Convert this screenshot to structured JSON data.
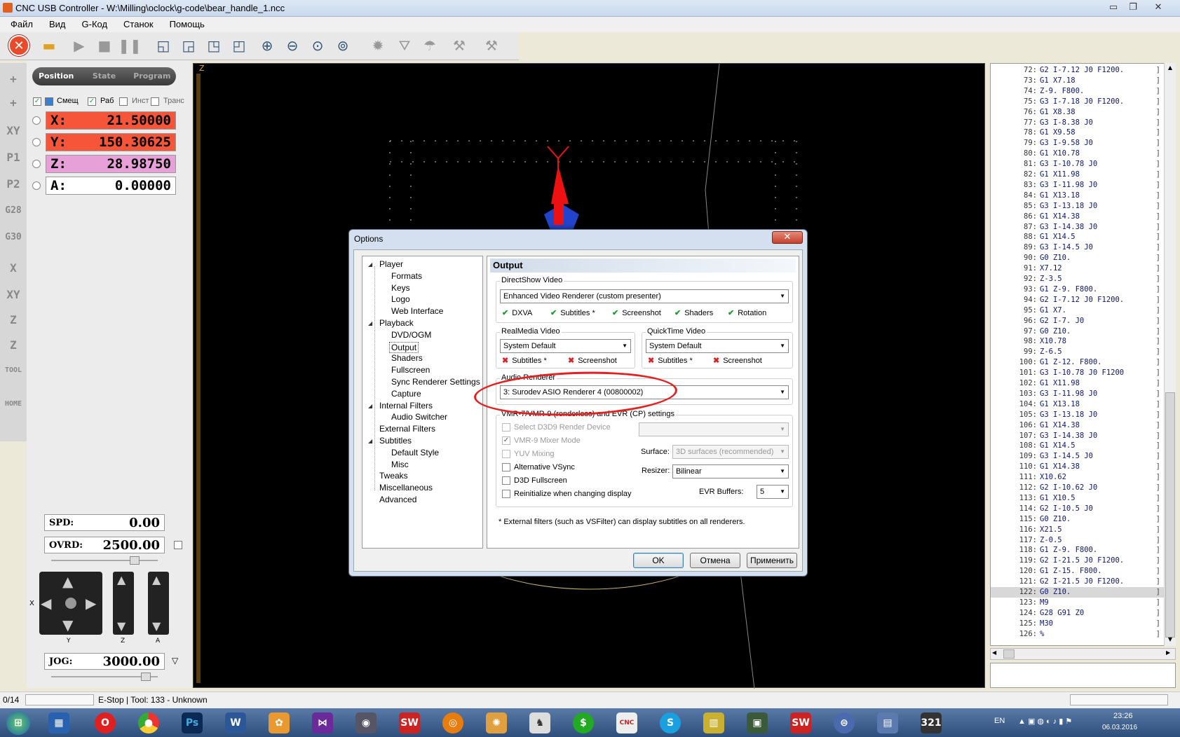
{
  "window": {
    "title": "CNC USB Controller - W:\\Milling\\oclock\\g-code\\bear_handle_1.ncc",
    "minimize": "▭",
    "restore": "❐",
    "close": "✕"
  },
  "menu": [
    "Файл",
    "Вид",
    "G-Код",
    "Станок",
    "Помощь"
  ],
  "position_panel": {
    "tabs": [
      "Position",
      "State",
      "Program"
    ],
    "checkboxes": [
      {
        "label": "Смещ",
        "checked": true
      },
      {
        "label": "Раб",
        "checked": true
      },
      {
        "label": "Инст",
        "checked": false
      },
      {
        "label": "Транс",
        "checked": false
      }
    ],
    "axes": [
      {
        "name": "X:",
        "value": "21.50000",
        "color": "#f7553a"
      },
      {
        "name": "Y:",
        "value": "150.30625",
        "color": "#f7553a"
      },
      {
        "name": "Z:",
        "value": "28.98750",
        "color": "#e8a0d8"
      },
      {
        "name": "A:",
        "value": "0.00000",
        "color": "#ffffff"
      }
    ]
  },
  "left_strip": [
    "+",
    "+",
    "XY",
    "P1",
    "P2",
    "G28",
    "G30",
    "X",
    "XY",
    "Z",
    "Z",
    "TOOL",
    "HOME"
  ],
  "controls": {
    "spd_label": "SPD:",
    "spd_value": "0.00",
    "ovrd_label": "OVRD:",
    "ovrd_value": "2500.00",
    "jog_label": "JOG:",
    "jog_value": "3000.00",
    "jog_axes": {
      "x": "X",
      "y": "Y",
      "z": "Z",
      "a": "A"
    }
  },
  "viewport": {
    "axis_label": "Z"
  },
  "gcode": [
    {
      "n": "72:",
      "t": "G2 I-7.12 J0 F1200."
    },
    {
      "n": "73:",
      "t": "G1 X7.18"
    },
    {
      "n": "74:",
      "t": "Z-9. F800."
    },
    {
      "n": "75:",
      "t": "G3 I-7.18 J0 F1200."
    },
    {
      "n": "76:",
      "t": "G1 X8.38"
    },
    {
      "n": "77:",
      "t": "G3 I-8.38 J0"
    },
    {
      "n": "78:",
      "t": "G1 X9.58"
    },
    {
      "n": "79:",
      "t": "G3 I-9.58 J0"
    },
    {
      "n": "80:",
      "t": "G1 X10.78"
    },
    {
      "n": "81:",
      "t": "G3 I-10.78 J0"
    },
    {
      "n": "82:",
      "t": "G1 X11.98"
    },
    {
      "n": "83:",
      "t": "G3 I-11.98 J0"
    },
    {
      "n": "84:",
      "t": "G1 X13.18"
    },
    {
      "n": "85:",
      "t": "G3 I-13.18 J0"
    },
    {
      "n": "86:",
      "t": "G1 X14.38"
    },
    {
      "n": "87:",
      "t": "G3 I-14.38 J0"
    },
    {
      "n": "88:",
      "t": "G1 X14.5"
    },
    {
      "n": "89:",
      "t": "G3 I-14.5 J0"
    },
    {
      "n": "90:",
      "t": "G0 Z10."
    },
    {
      "n": "91:",
      "t": "X7.12"
    },
    {
      "n": "92:",
      "t": "Z-3.5"
    },
    {
      "n": "93:",
      "t": "G1 Z-9. F800."
    },
    {
      "n": "94:",
      "t": "G2 I-7.12 J0 F1200."
    },
    {
      "n": "95:",
      "t": "G1 X7."
    },
    {
      "n": "96:",
      "t": "G2 I-7. J0"
    },
    {
      "n": "97:",
      "t": "G0 Z10."
    },
    {
      "n": "98:",
      "t": "X10.78"
    },
    {
      "n": "99:",
      "t": "Z-6.5"
    },
    {
      "n": "100:",
      "t": "G1 Z-12. F800."
    },
    {
      "n": "101:",
      "t": "G3 I-10.78 J0 F1200"
    },
    {
      "n": "102:",
      "t": "G1 X11.98"
    },
    {
      "n": "103:",
      "t": "G3 I-11.98 J0"
    },
    {
      "n": "104:",
      "t": "G1 X13.18"
    },
    {
      "n": "105:",
      "t": "G3 I-13.18 J0"
    },
    {
      "n": "106:",
      "t": "G1 X14.38"
    },
    {
      "n": "107:",
      "t": "G3 I-14.38 J0"
    },
    {
      "n": "108:",
      "t": "G1 X14.5"
    },
    {
      "n": "109:",
      "t": "G3 I-14.5 J0"
    },
    {
      "n": "110:",
      "t": "G1 X14.38"
    },
    {
      "n": "111:",
      "t": "X10.62"
    },
    {
      "n": "112:",
      "t": "G2 I-10.62 J0"
    },
    {
      "n": "113:",
      "t": "G1 X10.5"
    },
    {
      "n": "114:",
      "t": "G2 I-10.5 J0"
    },
    {
      "n": "115:",
      "t": "G0 Z10."
    },
    {
      "n": "116:",
      "t": "X21.5"
    },
    {
      "n": "117:",
      "t": "Z-0.5"
    },
    {
      "n": "118:",
      "t": "G1 Z-9. F800."
    },
    {
      "n": "119:",
      "t": "G2 I-21.5 J0 F1200."
    },
    {
      "n": "120:",
      "t": "G1 Z-15. F800."
    },
    {
      "n": "121:",
      "t": "G2 I-21.5 J0 F1200."
    },
    {
      "n": "122:",
      "t": "G0 Z10."
    },
    {
      "n": "123:",
      "t": "M9"
    },
    {
      "n": "124:",
      "t": "G28 G91 Z0"
    },
    {
      "n": "125:",
      "t": "M30"
    },
    {
      "n": "126:",
      "t": "%"
    }
  ],
  "status": {
    "progress": "0/14",
    "info": "E-Stop | Tool: 133 - Unknown"
  },
  "tray": {
    "lang": "EN",
    "time": "23:26",
    "date": "06.03.2016"
  },
  "dialog": {
    "title": "Options",
    "close": "✕",
    "tree": [
      {
        "label": "Player",
        "level": 0,
        "arrow": true
      },
      {
        "label": "Formats",
        "level": 1
      },
      {
        "label": "Keys",
        "level": 1
      },
      {
        "label": "Logo",
        "level": 1
      },
      {
        "label": "Web Interface",
        "level": 1
      },
      {
        "label": "Playback",
        "level": 0,
        "arrow": true
      },
      {
        "label": "DVD/OGM",
        "level": 1
      },
      {
        "label": "Output",
        "level": 1,
        "selected": true
      },
      {
        "label": "Shaders",
        "level": 1
      },
      {
        "label": "Fullscreen",
        "level": 1
      },
      {
        "label": "Sync Renderer Settings",
        "level": 1
      },
      {
        "label": "Capture",
        "level": 1
      },
      {
        "label": "Internal Filters",
        "level": 0,
        "arrow": true
      },
      {
        "label": "Audio Switcher",
        "level": 1
      },
      {
        "label": "External Filters",
        "level": 0
      },
      {
        "label": "Subtitles",
        "level": 0,
        "arrow": true
      },
      {
        "label": "Default Style",
        "level": 1
      },
      {
        "label": "Misc",
        "level": 1
      },
      {
        "label": "Tweaks",
        "level": 0
      },
      {
        "label": "Miscellaneous",
        "level": 0
      },
      {
        "label": "Advanced",
        "level": 0
      }
    ],
    "page_title": "Output",
    "directshow": {
      "label": "DirectShow Video",
      "value": "Enhanced Video Renderer (custom presenter)",
      "features": [
        "DXVA",
        "Subtitles *",
        "Screenshot",
        "Shaders",
        "Rotation"
      ]
    },
    "realmedia": {
      "label": "RealMedia Video",
      "value": "System Default",
      "features": [
        "Subtitles *",
        "Screenshot"
      ]
    },
    "quicktime": {
      "label": "QuickTime Video",
      "value": "System Default",
      "features": [
        "Subtitles *",
        "Screenshot"
      ]
    },
    "audio": {
      "label": "Audio Renderer",
      "value": "3: Surodev ASIO Renderer 4 (00800002)"
    },
    "vmr": {
      "label": "VMR-7/VMR-9 (renderless) and EVR (CP) settings",
      "options": [
        {
          "label": "Select D3D9 Render Device",
          "checked": false,
          "disabled": true
        },
        {
          "label": "VMR-9 Mixer Mode",
          "checked": true,
          "disabled": true
        },
        {
          "label": "YUV Mixing",
          "checked": false,
          "disabled": true
        },
        {
          "label": "Alternative VSync",
          "checked": false,
          "disabled": false
        },
        {
          "label": "D3D Fullscreen",
          "checked": false,
          "disabled": false
        },
        {
          "label": "Reinitialize when changing display",
          "checked": false,
          "disabled": false
        }
      ],
      "surface_label": "Surface:",
      "surface_value": "3D surfaces (recommended)",
      "resizer_label": "Resizer:",
      "resizer_value": "Bilinear",
      "evr_label": "EVR Buffers:",
      "evr_value": "5"
    },
    "footnote": "* External filters (such as VSFilter) can display subtitles on all renderers.",
    "buttons": {
      "ok": "OK",
      "cancel": "Отмена",
      "apply": "Применить"
    }
  }
}
